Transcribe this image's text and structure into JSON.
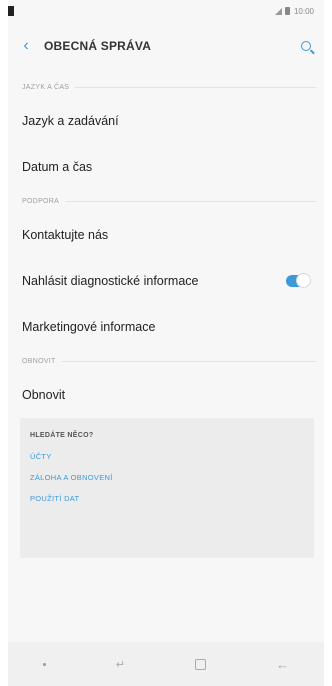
{
  "status": {
    "time": "10:00"
  },
  "header": {
    "title": "OBECNÁ SPRÁVA",
    "back_icon": "chevron-left-icon",
    "search_icon": "search-icon"
  },
  "sections": [
    {
      "header": "JAZYK A ČAS",
      "items": [
        "Jazyk a zadávání",
        "Datum a čas"
      ]
    },
    {
      "header": "PODPORA",
      "items": [
        "Kontaktujte nás",
        "Nahlásit diagnostické informace",
        "Marketingové informace"
      ]
    },
    {
      "header": "OBNOVIT",
      "items": [
        "Obnovit"
      ]
    }
  ],
  "diagnostics_toggle": {
    "state": "on"
  },
  "suggestions": {
    "title": "HLEDÁTE NĚCO?",
    "links": [
      "ÚČTY",
      "ZÁLOHA A OBNOVENÍ",
      "POUŽITÍ DAT"
    ]
  },
  "colors": {
    "accent": "#3b9ad8",
    "background": "#f7f7f7"
  }
}
